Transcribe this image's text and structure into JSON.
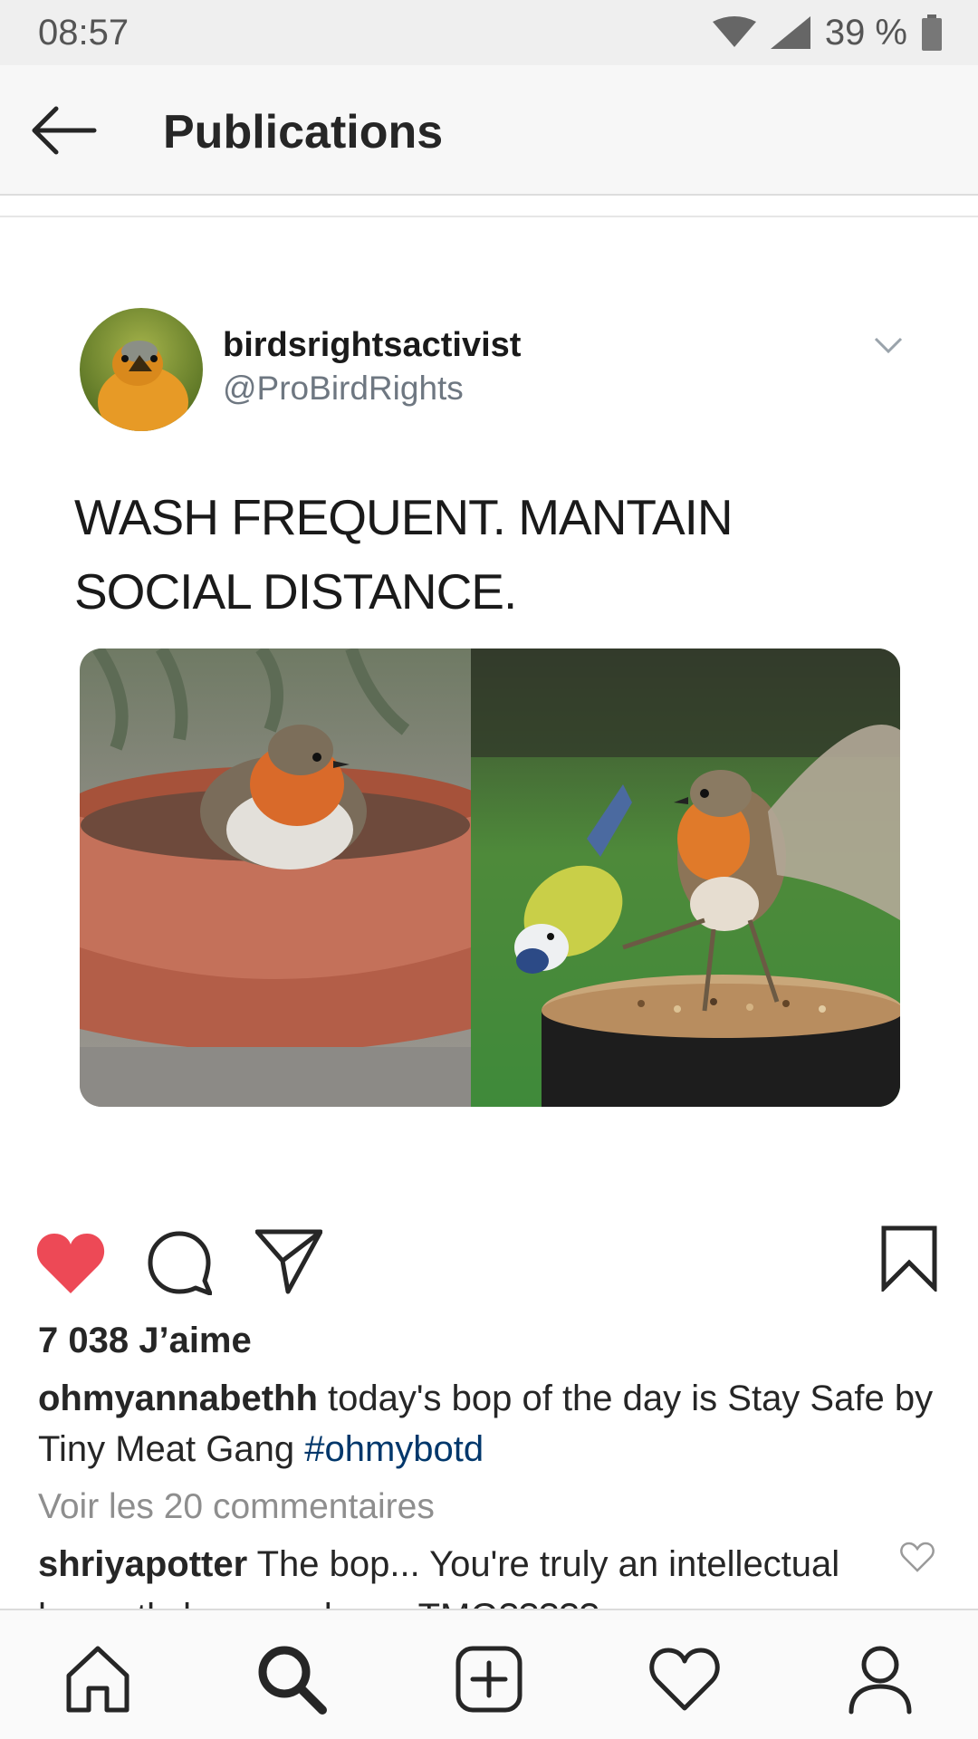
{
  "status_bar": {
    "time": "08:57",
    "battery": "39 %"
  },
  "header": {
    "title": "Publications"
  },
  "tweet": {
    "display_name": "birdsrightsactivist",
    "handle": "@ProBirdRights",
    "text": "WASH FREQUENT. MANTAIN\nSOCIAL DISTANCE."
  },
  "post": {
    "likes": "7 038 J’aime",
    "caption_user": "ohmyannabethh",
    "caption_text": " today's bop of the day is Stay Safe by Tiny Meat Gang ",
    "caption_hashtag": "#ohmybotd",
    "view_comments": "Voir les 20 commentaires",
    "comment_user": "shriyapotter",
    "comment_text": " The bop... You're truly an intellectual",
    "comment_overflow": "honestly knop and now TMG?????"
  },
  "colors": {
    "like_red": "#ed4956",
    "link_blue": "#00376b"
  },
  "icons": {
    "back": "arrow-left-icon",
    "like": "heart-filled-icon",
    "comment": "comment-bubble-icon",
    "share": "paper-plane-icon",
    "save": "bookmark-icon",
    "home": "home-icon",
    "search": "search-icon",
    "new_post": "plus-square-icon",
    "activity": "heart-outline-icon",
    "profile": "profile-icon"
  }
}
